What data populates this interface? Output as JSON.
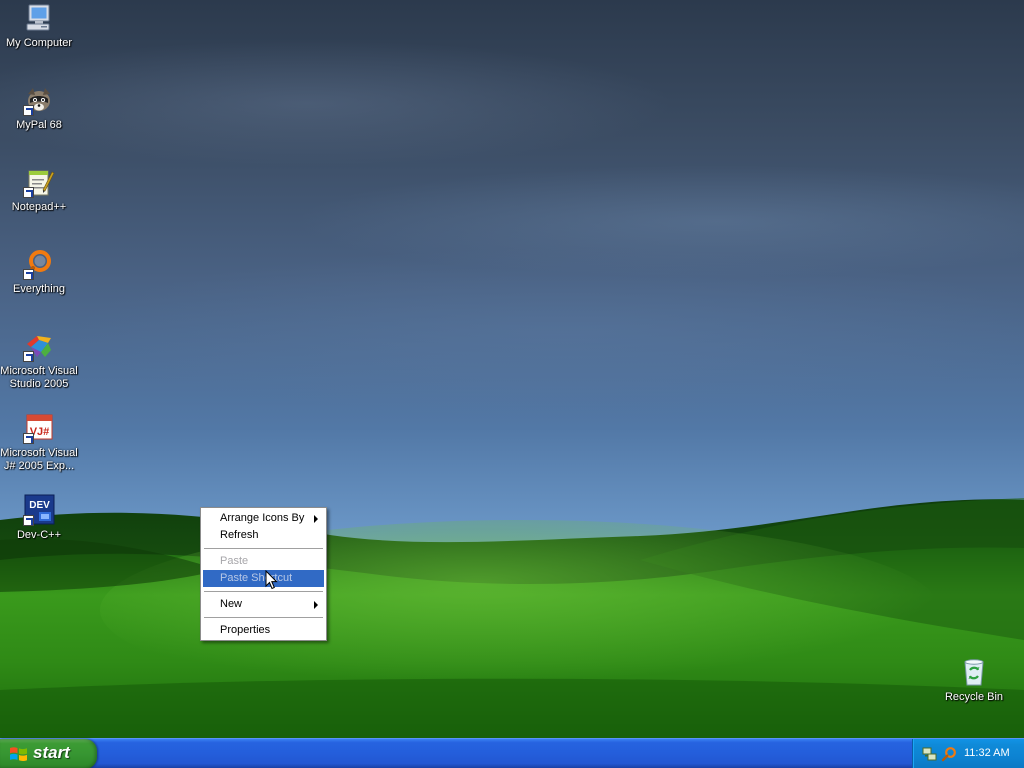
{
  "desktop": {
    "icons": [
      {
        "label_lines": [
          "My Computer"
        ],
        "icon": "my-computer-icon"
      },
      {
        "label_lines": [
          "MyPal 68"
        ],
        "icon": "mypal-icon"
      },
      {
        "label_lines": [
          "Notepad++"
        ],
        "icon": "notepad-plus-plus-icon"
      },
      {
        "label_lines": [
          "Everything"
        ],
        "icon": "everything-search-icon"
      },
      {
        "label_lines": [
          "Microsoft Visual",
          "Studio 2005"
        ],
        "icon": "visual-studio-icon"
      },
      {
        "label_lines": [
          "Microsoft Visual",
          "J# 2005 Exp..."
        ],
        "icon": "visual-jsharp-icon",
        "glyph_text": "VJ#"
      },
      {
        "label_lines": [
          "Dev-C++"
        ],
        "icon": "dev-cpp-icon",
        "glyph_text": "DEV"
      }
    ],
    "recycle_bin": {
      "label": "Recycle Bin",
      "icon": "recycle-bin-icon"
    }
  },
  "context_menu": {
    "arrange_icons_by": "Arrange Icons By",
    "refresh": "Refresh",
    "paste": "Paste",
    "paste_shortcut": "Paste Shortcut",
    "new": "New",
    "properties": "Properties"
  },
  "taskbar": {
    "start_label": "start",
    "clock": "11:32 AM",
    "tray_icons": [
      "network-icon",
      "search-tray-icon"
    ]
  },
  "colors": {
    "menu_highlight": "#316ac5",
    "taskbar_blue": "#245edb",
    "start_green": "#379632",
    "tray_blue": "#0f8ad8"
  }
}
